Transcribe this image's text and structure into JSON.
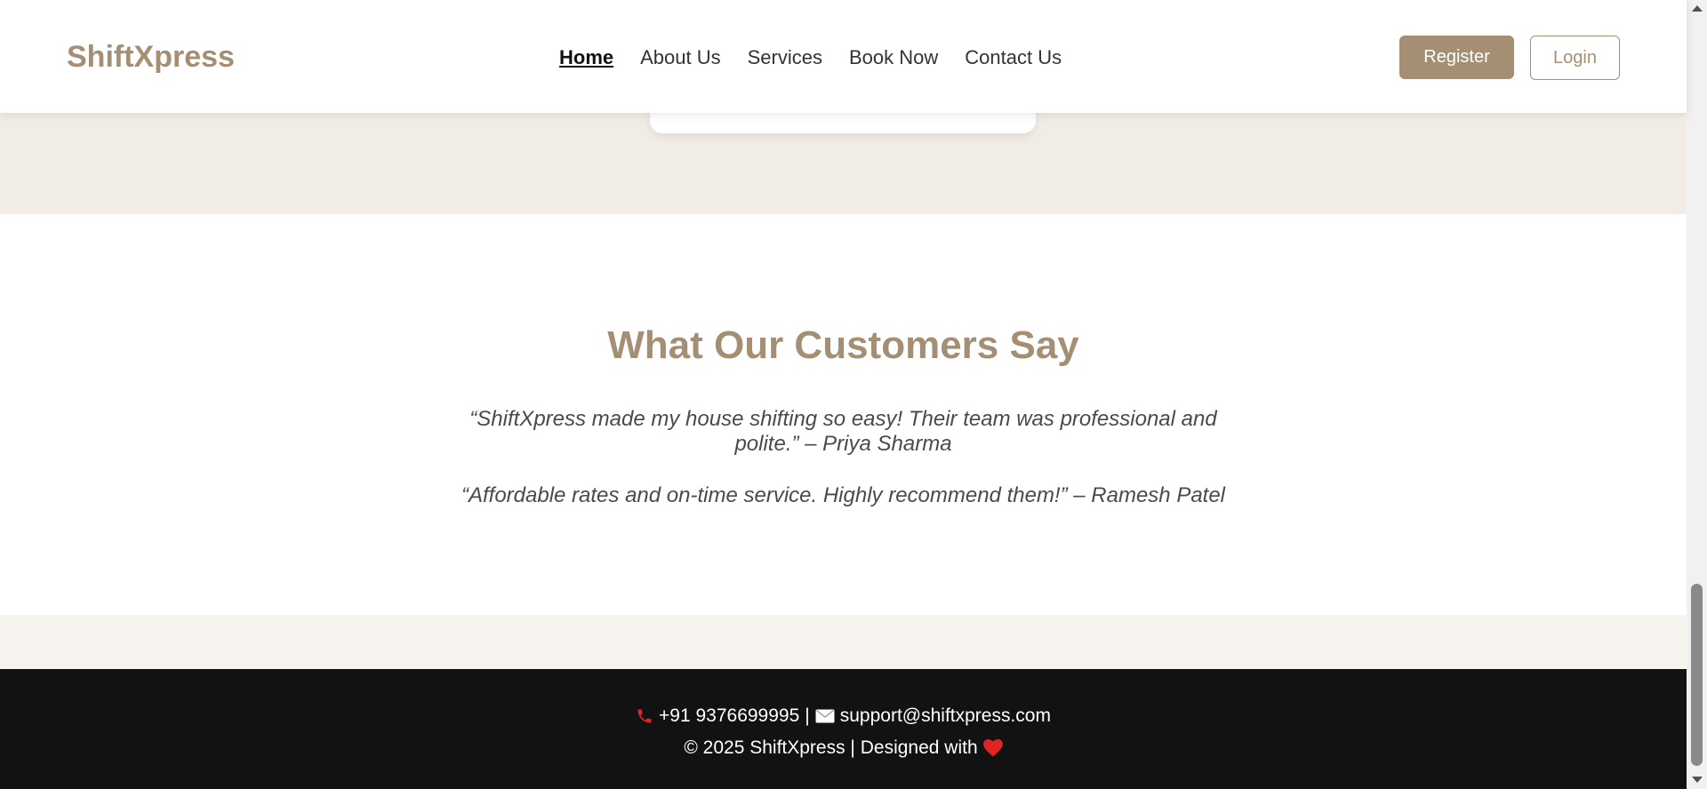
{
  "header": {
    "logo": "ShiftXpress",
    "nav": [
      {
        "label": "Home",
        "active": true
      },
      {
        "label": "About Us",
        "active": false
      },
      {
        "label": "Services",
        "active": false
      },
      {
        "label": "Book Now",
        "active": false
      },
      {
        "label": "Contact Us",
        "active": false
      }
    ],
    "register_label": "Register",
    "login_label": "Login"
  },
  "testimonials": {
    "title": "What Our Customers Say",
    "quotes": [
      "“ShiftXpress made my house shifting so easy! Their team was professional and polite.” – Priya Sharma",
      "“Affordable rates and on-time service. Highly recommend them!” – Ramesh Patel"
    ]
  },
  "footer": {
    "phone_icon": "phone-icon",
    "phone": "+91 9376699995",
    "separator": "|",
    "email_icon": "envelope-icon",
    "email": "support@shiftxpress.com",
    "copyright": "© 2025 ShiftXpress | Designed with",
    "heart_icon": "heart-icon"
  },
  "colors": {
    "brand": "#a58f74",
    "footer_bg": "#121212",
    "beige_band": "#f1ece6",
    "cream_band": "#f7f4ef",
    "heart": "#e02424",
    "phone_icon": "#e02424"
  }
}
